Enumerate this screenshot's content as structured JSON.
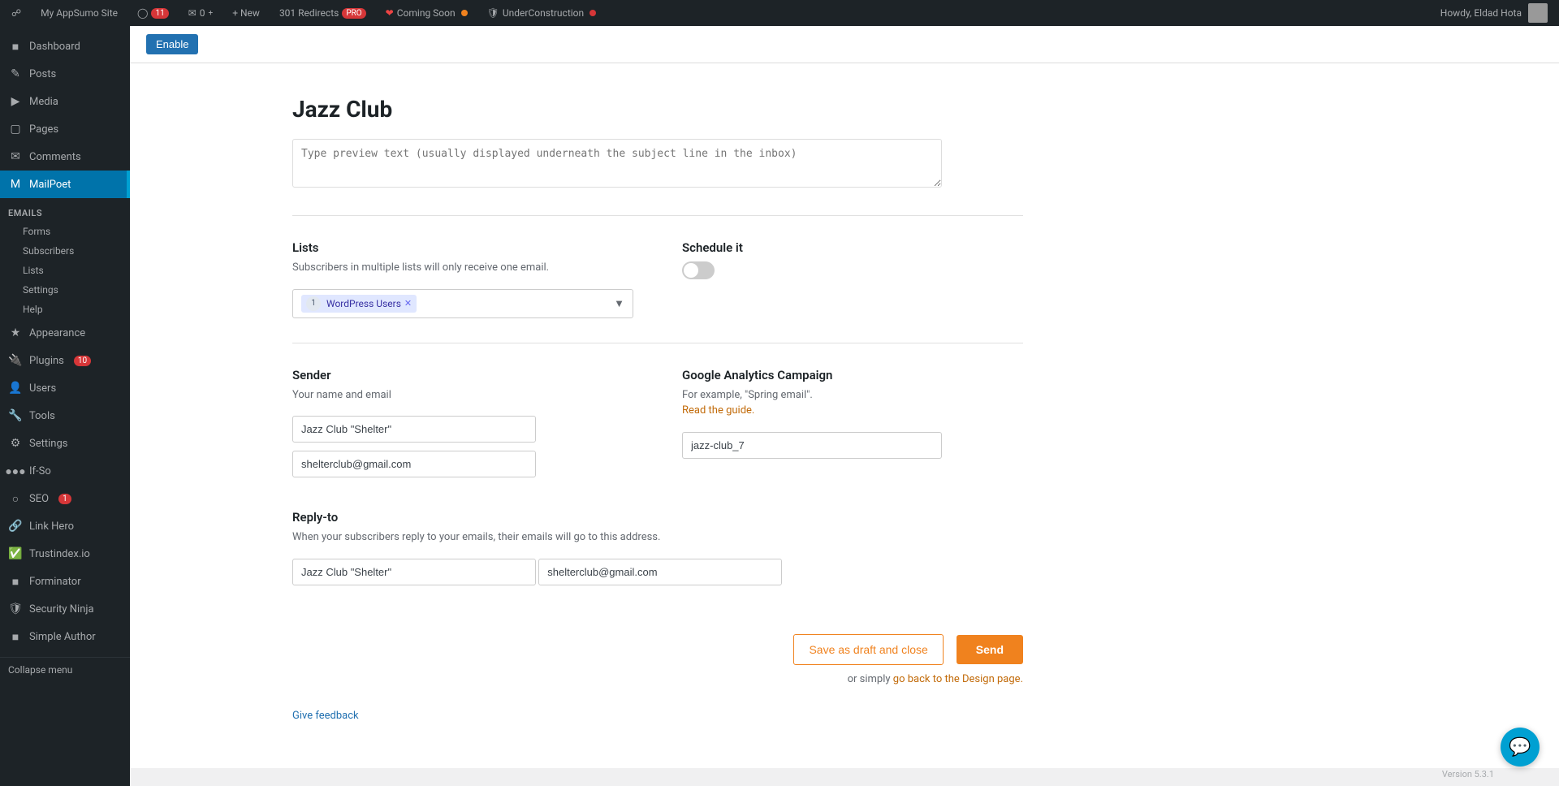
{
  "admin_bar": {
    "site_name": "My AppSumo Site",
    "wp_icon": "⊞",
    "updates_count": "11",
    "comments_count": "0",
    "new_label": "+ New",
    "redirects_label": "301 Redirects",
    "redirects_badge": "PRO",
    "coming_soon_label": "Coming Soon",
    "underconstruction_label": "UnderConstruction",
    "howdy_text": "Howdy, Eldad Hota"
  },
  "sidebar": {
    "dashboard_label": "Dashboard",
    "posts_label": "Posts",
    "media_label": "Media",
    "pages_label": "Pages",
    "comments_label": "Comments",
    "mailpoet_label": "MailPoet",
    "emails_section": "Emails",
    "forms_label": "Forms",
    "subscribers_label": "Subscribers",
    "lists_label": "Lists",
    "settings_label": "Settings",
    "help_label": "Help",
    "appearance_label": "Appearance",
    "plugins_label": "Plugins",
    "plugins_badge": "10",
    "users_label": "Users",
    "tools_label": "Tools",
    "settings2_label": "Settings",
    "ifso_label": "If-So",
    "seo_label": "SEO",
    "seo_badge": "1",
    "linkhero_label": "Link Hero",
    "trustindex_label": "Trustindex.io",
    "forminator_label": "Forminator",
    "security_ninja_label": "Security Ninja",
    "simple_author_label": "Simple Author",
    "collapse_label": "Collapse menu"
  },
  "enable_button": "Enable",
  "email": {
    "title": "Jazz Club",
    "preview_placeholder": "Type preview text (usually displayed underneath the subject line in the inbox)"
  },
  "lists_section": {
    "title": "Lists",
    "description": "Subscribers in multiple lists will only receive one email.",
    "selected_list": "WordPress Users",
    "list_count": "1"
  },
  "schedule_section": {
    "title": "Schedule it",
    "enabled": false
  },
  "sender_section": {
    "title": "Sender",
    "description": "Your name and email",
    "name_value": "Jazz Club \"Shelter\"",
    "email_value": "shelterclub@gmail.com"
  },
  "analytics_section": {
    "title": "Google Analytics Campaign",
    "description": "For example, \"Spring email\".",
    "guide_link": "Read the guide.",
    "value": "jazz-club_7"
  },
  "replyto_section": {
    "title": "Reply-to",
    "description": "When your subscribers reply to your emails, their emails will go to this address.",
    "name_value": "Jazz Club \"Shelter\"",
    "email_value": "shelterclub@gmail.com"
  },
  "actions": {
    "save_draft_label": "Save as draft and close",
    "send_label": "Send",
    "or_text": "or simply",
    "design_page_link": "go back to the Design page."
  },
  "feedback_label": "Give feedback",
  "version_label": "Version 5.3.1"
}
